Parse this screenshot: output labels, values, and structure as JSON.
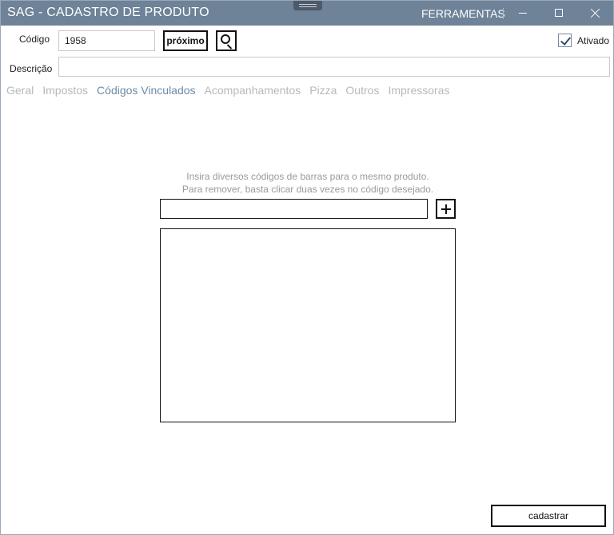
{
  "window": {
    "title": "SAG - CADASTRO DE PRODUTO",
    "tools_label": "FERRAMENTAS"
  },
  "form": {
    "codigo_label": "Código",
    "codigo_value": "1958",
    "proximo_label": "próximo",
    "ativado_label": "Ativado",
    "ativado_checked": true,
    "descricao_label": "Descrição",
    "descricao_value": ""
  },
  "tabs": [
    {
      "label": "Geral",
      "active": false
    },
    {
      "label": "Impostos",
      "active": false
    },
    {
      "label": "Códigos Vinculados",
      "active": true
    },
    {
      "label": "Acompanhamentos",
      "active": false
    },
    {
      "label": "Pizza",
      "active": false
    },
    {
      "label": "Outros",
      "active": false
    },
    {
      "label": "Impressoras",
      "active": false
    }
  ],
  "codigos": {
    "hint_line1": "Insira diversos códigos de barras para o mesmo produto.",
    "hint_line2": "Para remover, basta clicar duas vezes no código desejado.",
    "new_code_value": "",
    "items": []
  },
  "footer": {
    "cadastrar_label": "cadastrar"
  },
  "icons": {
    "search": "search-icon",
    "add": "plus-icon",
    "check": "check-icon",
    "minimize": "minimize-icon",
    "maximize": "maximize-icon",
    "close": "close-icon"
  },
  "colors": {
    "titlebar": "#6e8298",
    "tab_active": "#6d8aa6",
    "tab_inactive": "#b5b9bd"
  }
}
